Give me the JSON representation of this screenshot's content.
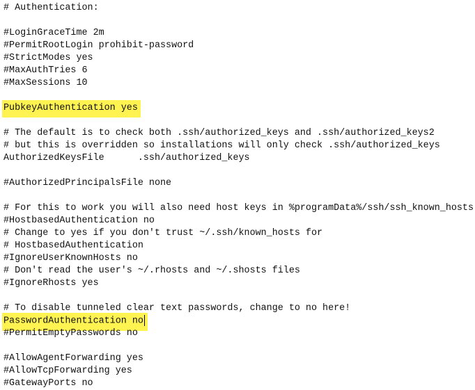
{
  "editor": {
    "highlight_color": "#fff352",
    "cursor_line": 25,
    "lines": [
      {
        "text": "# Authentication:"
      },
      {
        "text": ""
      },
      {
        "text": "#LoginGraceTime 2m"
      },
      {
        "text": "#PermitRootLogin prohibit-password"
      },
      {
        "text": "#StrictModes yes"
      },
      {
        "text": "#MaxAuthTries 6"
      },
      {
        "text": "#MaxSessions 10"
      },
      {
        "text": ""
      },
      {
        "text": "PubkeyAuthentication yes",
        "highlighted": true
      },
      {
        "text": ""
      },
      {
        "text": "# The default is to check both .ssh/authorized_keys and .ssh/authorized_keys2"
      },
      {
        "text": "# but this is overridden so installations will only check .ssh/authorized_keys"
      },
      {
        "text": "AuthorizedKeysFile      .ssh/authorized_keys"
      },
      {
        "text": ""
      },
      {
        "text": "#AuthorizedPrincipalsFile none"
      },
      {
        "text": ""
      },
      {
        "text": "# For this to work you will also need host keys in %programData%/ssh/ssh_known_hosts"
      },
      {
        "text": "#HostbasedAuthentication no"
      },
      {
        "text": "# Change to yes if you don't trust ~/.ssh/known_hosts for"
      },
      {
        "text": "# HostbasedAuthentication"
      },
      {
        "text": "#IgnoreUserKnownHosts no"
      },
      {
        "text": "# Don't read the user's ~/.rhosts and ~/.shosts files"
      },
      {
        "text": "#IgnoreRhosts yes"
      },
      {
        "text": ""
      },
      {
        "text": "# To disable tunneled clear text passwords, change to no here!"
      },
      {
        "text": "PasswordAuthentication no",
        "highlighted": true
      },
      {
        "text": "#PermitEmptyPasswords no"
      },
      {
        "text": ""
      },
      {
        "text": "#AllowAgentForwarding yes"
      },
      {
        "text": "#AllowTcpForwarding yes"
      },
      {
        "text": "#GatewayPorts no"
      }
    ]
  }
}
